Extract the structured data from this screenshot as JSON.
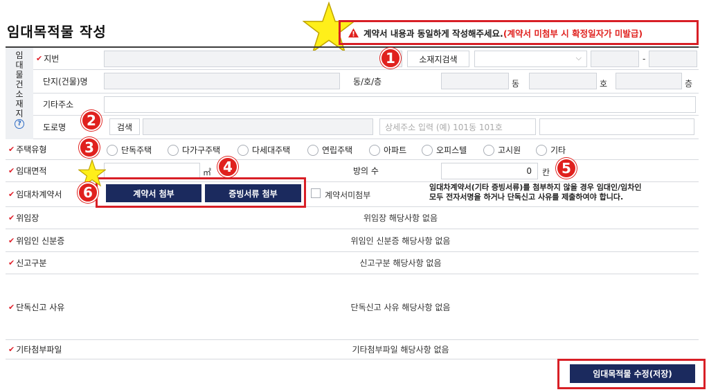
{
  "page": {
    "title": "임대목적물 작성"
  },
  "warning": {
    "text": "계약서 내용과 동일하게 작성해주세요.",
    "red_text": "(계약서 미첨부 시 확정일자가 미발급)"
  },
  "location": {
    "group_label_chars": [
      "임",
      "대",
      "물",
      "건",
      "소",
      "재",
      "지"
    ],
    "help_glyph": "?",
    "jibun_label": "지번",
    "search_button": "소재지검색",
    "dash": "-",
    "complex_label": "단지(건물)명",
    "dong_ho_label": "동/호/층",
    "dong_unit": "동",
    "ho_unit": "호",
    "floor_unit": "층",
    "other_addr_label": "기타주소",
    "road_label": "도로명",
    "road_search_button": "검색",
    "detail_placeholder": "상세주소 입력 (예) 101동 101호"
  },
  "house_type": {
    "label": "주택유형",
    "options": [
      "단독주택",
      "다가구주택",
      "다세대주택",
      "연립주택",
      "아파트",
      "오피스텔",
      "고시원",
      "기타"
    ]
  },
  "area": {
    "label": "임대면적",
    "unit": "㎡",
    "rooms_label": "방의 수",
    "rooms_value": "0",
    "rooms_unit": "칸"
  },
  "contract": {
    "label": "임대차계약서",
    "attach_button": "계약서 첨부",
    "evidence_button": "증빙서류 첨부",
    "no_attach_label": "계약서미첨부",
    "notice_line1": "임대차계약서(기타 증빙서류)를 첨부하지 않을 경우 임대인/임차인",
    "notice_line2": "모두 전자서명을 하거나 단독신고 사유를 제출하여야 합니다."
  },
  "rows": [
    {
      "label": "위임장",
      "value": "위임장 해당사항 없음"
    },
    {
      "label": "위임인 신분증",
      "value": "위임인 신분증 해당사항 없음"
    },
    {
      "label": "신고구분",
      "value": "신고구분 해당사항 없음"
    },
    {
      "label": "단독신고 사유",
      "value": "단독신고 사유 해당사항 없음"
    },
    {
      "label": "기타첨부파일",
      "value": "기타첨부파일 해당사항 없음"
    }
  ],
  "save_button": "임대목적물 수정(저장)",
  "badges": [
    "1",
    "2",
    "3",
    "4",
    "5",
    "6"
  ],
  "colors": {
    "accent_red": "#e0211e",
    "navy": "#1b2a5e",
    "star_yellow": "#ffef1a"
  }
}
